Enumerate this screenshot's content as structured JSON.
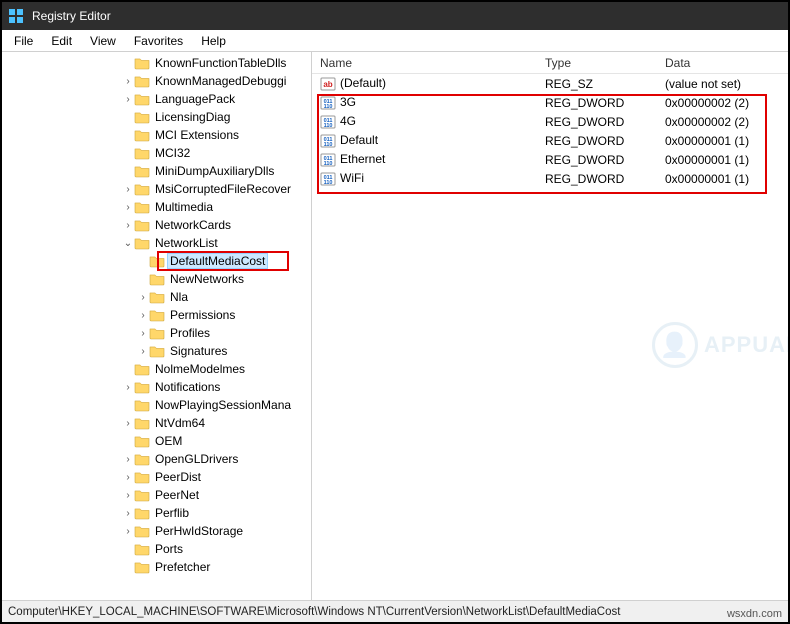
{
  "title": "Registry Editor",
  "menu": [
    "File",
    "Edit",
    "View",
    "Favorites",
    "Help"
  ],
  "tree": [
    {
      "indent": 8,
      "label": "KnownFunctionTableDlls",
      "expander": ""
    },
    {
      "indent": 8,
      "label": "KnownManagedDebuggi",
      "expander": "›"
    },
    {
      "indent": 8,
      "label": "LanguagePack",
      "expander": "›"
    },
    {
      "indent": 8,
      "label": "LicensingDiag",
      "expander": ""
    },
    {
      "indent": 8,
      "label": "MCI Extensions",
      "expander": ""
    },
    {
      "indent": 8,
      "label": "MCI32",
      "expander": ""
    },
    {
      "indent": 8,
      "label": "MiniDumpAuxiliaryDlls",
      "expander": ""
    },
    {
      "indent": 8,
      "label": "MsiCorruptedFileRecover",
      "expander": "›"
    },
    {
      "indent": 8,
      "label": "Multimedia",
      "expander": "›"
    },
    {
      "indent": 8,
      "label": "NetworkCards",
      "expander": "›"
    },
    {
      "indent": 8,
      "label": "NetworkList",
      "expander": "⌄"
    },
    {
      "indent": 9,
      "label": "DefaultMediaCost",
      "expander": "",
      "selected": true
    },
    {
      "indent": 9,
      "label": "NewNetworks",
      "expander": ""
    },
    {
      "indent": 9,
      "label": "Nla",
      "expander": "›"
    },
    {
      "indent": 9,
      "label": "Permissions",
      "expander": "›"
    },
    {
      "indent": 9,
      "label": "Profiles",
      "expander": "›"
    },
    {
      "indent": 9,
      "label": "Signatures",
      "expander": "›"
    },
    {
      "indent": 8,
      "label": "NolmeModelmes",
      "expander": ""
    },
    {
      "indent": 8,
      "label": "Notifications",
      "expander": "›"
    },
    {
      "indent": 8,
      "label": "NowPlayingSessionMana",
      "expander": ""
    },
    {
      "indent": 8,
      "label": "NtVdm64",
      "expander": "›"
    },
    {
      "indent": 8,
      "label": "OEM",
      "expander": ""
    },
    {
      "indent": 8,
      "label": "OpenGLDrivers",
      "expander": "›"
    },
    {
      "indent": 8,
      "label": "PeerDist",
      "expander": "›"
    },
    {
      "indent": 8,
      "label": "PeerNet",
      "expander": "›"
    },
    {
      "indent": 8,
      "label": "Perflib",
      "expander": "›"
    },
    {
      "indent": 8,
      "label": "PerHwIdStorage",
      "expander": "›"
    },
    {
      "indent": 8,
      "label": "Ports",
      "expander": ""
    },
    {
      "indent": 8,
      "label": "Prefetcher",
      "expander": ""
    }
  ],
  "columns": {
    "name": "Name",
    "type": "Type",
    "data": "Data"
  },
  "values": [
    {
      "icon": "sz",
      "name": "(Default)",
      "type": "REG_SZ",
      "data": "(value not set)"
    },
    {
      "icon": "dw",
      "name": "3G",
      "type": "REG_DWORD",
      "data": "0x00000002 (2)"
    },
    {
      "icon": "dw",
      "name": "4G",
      "type": "REG_DWORD",
      "data": "0x00000002 (2)"
    },
    {
      "icon": "dw",
      "name": "Default",
      "type": "REG_DWORD",
      "data": "0x00000001 (1)"
    },
    {
      "icon": "dw",
      "name": "Ethernet",
      "type": "REG_DWORD",
      "data": "0x00000001 (1)"
    },
    {
      "icon": "dw",
      "name": "WiFi",
      "type": "REG_DWORD",
      "data": "0x00000001 (1)"
    }
  ],
  "statusbar": "Computer\\HKEY_LOCAL_MACHINE\\SOFTWARE\\Microsoft\\Windows NT\\CurrentVersion\\NetworkList\\DefaultMediaCost",
  "attribution": "wsxdn.com",
  "watermark": "APPUALS"
}
